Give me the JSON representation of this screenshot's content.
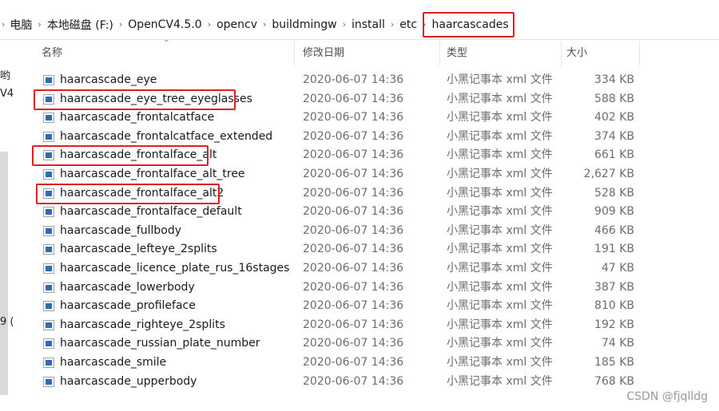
{
  "address_bar": {
    "crumbs": [
      "电脑",
      "本地磁盘 (F:)",
      "OpenCV4.5.0",
      "opencv",
      "buildmingw",
      "install",
      "etc",
      "haarcascades"
    ]
  },
  "nav_pane": {
    "fragments": [
      "哟",
      "V4",
      "9 ("
    ]
  },
  "columns": {
    "name": "名称",
    "modified": "修改日期",
    "type": "类型",
    "size": "大小"
  },
  "files": [
    {
      "name": "haarcascade_eye",
      "modified": "2020-06-07 14:36",
      "type": "小黑记事本 xml 文件",
      "size": "334 KB",
      "highlighted": false
    },
    {
      "name": "haarcascade_eye_tree_eyeglasses",
      "modified": "2020-06-07 14:36",
      "type": "小黑记事本 xml 文件",
      "size": "588 KB",
      "highlighted": true
    },
    {
      "name": "haarcascade_frontalcatface",
      "modified": "2020-06-07 14:36",
      "type": "小黑记事本 xml 文件",
      "size": "402 KB",
      "highlighted": false
    },
    {
      "name": "haarcascade_frontalcatface_extended",
      "modified": "2020-06-07 14:36",
      "type": "小黑记事本 xml 文件",
      "size": "374 KB",
      "highlighted": false
    },
    {
      "name": "haarcascade_frontalface_alt",
      "modified": "2020-06-07 14:36",
      "type": "小黑记事本 xml 文件",
      "size": "661 KB",
      "highlighted": true
    },
    {
      "name": "haarcascade_frontalface_alt_tree",
      "modified": "2020-06-07 14:36",
      "type": "小黑记事本 xml 文件",
      "size": "2,627 KB",
      "highlighted": false
    },
    {
      "name": "haarcascade_frontalface_alt2",
      "modified": "2020-06-07 14:36",
      "type": "小黑记事本 xml 文件",
      "size": "528 KB",
      "highlighted": true
    },
    {
      "name": "haarcascade_frontalface_default",
      "modified": "2020-06-07 14:36",
      "type": "小黑记事本 xml 文件",
      "size": "909 KB",
      "highlighted": false
    },
    {
      "name": "haarcascade_fullbody",
      "modified": "2020-06-07 14:36",
      "type": "小黑记事本 xml 文件",
      "size": "466 KB",
      "highlighted": false
    },
    {
      "name": "haarcascade_lefteye_2splits",
      "modified": "2020-06-07 14:36",
      "type": "小黑记事本 xml 文件",
      "size": "191 KB",
      "highlighted": false
    },
    {
      "name": "haarcascade_licence_plate_rus_16stages",
      "modified": "2020-06-07 14:36",
      "type": "小黑记事本 xml 文件",
      "size": "47 KB",
      "highlighted": false
    },
    {
      "name": "haarcascade_lowerbody",
      "modified": "2020-06-07 14:36",
      "type": "小黑记事本 xml 文件",
      "size": "387 KB",
      "highlighted": false
    },
    {
      "name": "haarcascade_profileface",
      "modified": "2020-06-07 14:36",
      "type": "小黑记事本 xml 文件",
      "size": "810 KB",
      "highlighted": false
    },
    {
      "name": "haarcascade_righteye_2splits",
      "modified": "2020-06-07 14:36",
      "type": "小黑记事本 xml 文件",
      "size": "192 KB",
      "highlighted": false
    },
    {
      "name": "haarcascade_russian_plate_number",
      "modified": "2020-06-07 14:36",
      "type": "小黑记事本 xml 文件",
      "size": "74 KB",
      "highlighted": false
    },
    {
      "name": "haarcascade_smile",
      "modified": "2020-06-07 14:36",
      "type": "小黑记事本 xml 文件",
      "size": "185 KB",
      "highlighted": false
    },
    {
      "name": "haarcascade_upperbody",
      "modified": "2020-06-07 14:36",
      "type": "小黑记事本 xml 文件",
      "size": "768 KB",
      "highlighted": false
    }
  ],
  "highlight_color": "#e02020",
  "icon": "xml-file-icon",
  "watermark": "CSDN @fjqlldg"
}
